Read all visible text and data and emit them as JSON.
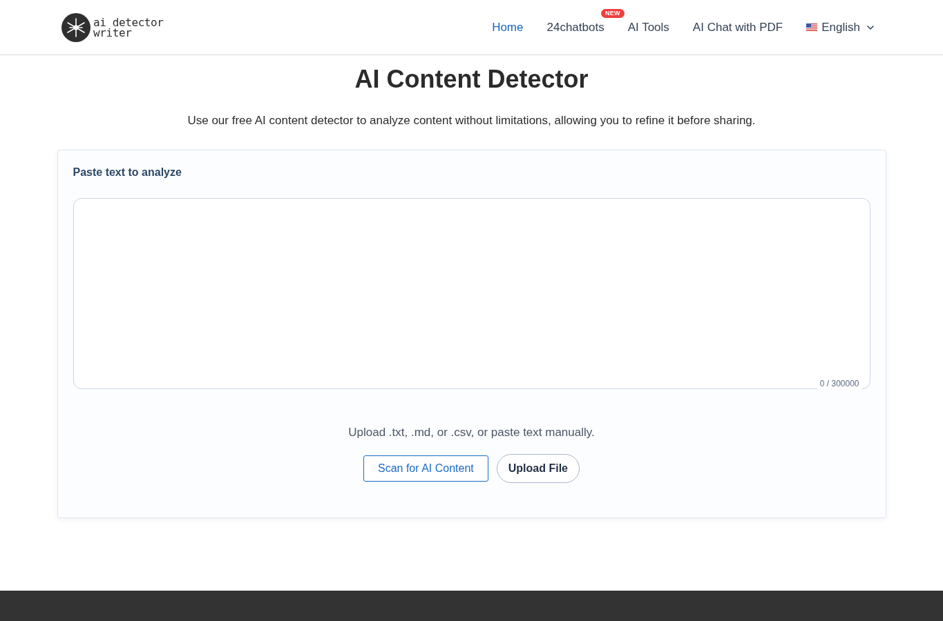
{
  "header": {
    "logo": {
      "line_1": "ai detector",
      "line_2": "writer"
    },
    "nav": [
      {
        "label": "Home",
        "selected": true
      },
      {
        "label": "24chatbots",
        "selected": false,
        "badge": "NEW"
      },
      {
        "label": "AI Tools",
        "selected": false
      },
      {
        "label": "AI Chat with PDF",
        "selected": false
      }
    ],
    "language": {
      "label": "English"
    }
  },
  "hero": {
    "title": "AI Content Detector",
    "subtitle": "Use our free AI content detector to analyze content without limitations, allowing you to refine it before sharing."
  },
  "analyzer": {
    "label": "Paste text to analyze",
    "text_input": {
      "counter": "0 / 300000"
    },
    "hint": "Upload .txt, .md, or .csv, or paste text manually.",
    "buttons": [
      {
        "label": "Scan for AI Content",
        "kind": "outline"
      },
      {
        "label": "Upload File",
        "kind": "pill"
      }
    ]
  }
}
